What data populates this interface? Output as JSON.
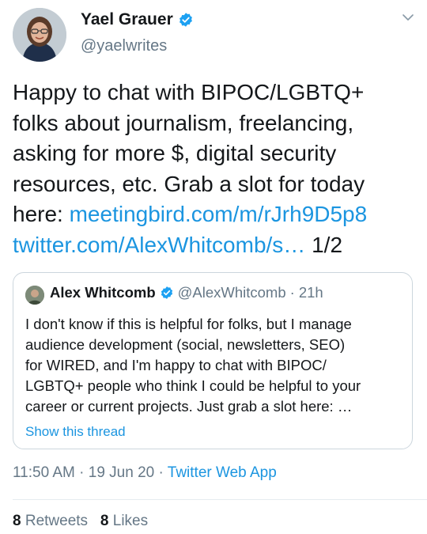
{
  "tweet": {
    "author_name": "Yael Grauer",
    "author_handle": "@yaelwrites",
    "verified_icon": "verified-badge-icon",
    "caret_icon": "chevron-down-icon",
    "text_lines": [
      "Happy to chat with BIPOC/LGBTQ+",
      "folks about journalism, freelancing,",
      "asking for more $, digital security",
      "resources, etc. Grab a slot for today"
    ],
    "line5_prefix": "here: ",
    "link1": "meetingbird.com/m/rJrh9D5p8",
    "link2": "twitter.com/AlexWhitcomb/s…",
    "thread_count": " 1/2",
    "time": "11:50 AM",
    "sep": " · ",
    "date": "19 Jun 20",
    "source": "Twitter Web App"
  },
  "quote": {
    "author_name": "Alex Whitcomb",
    "author_handle": "@AlexWhitcomb",
    "time_ago": "21h",
    "text_lines": [
      "I don't know if this is helpful for folks, but I manage",
      "audience development (social, newsletters, SEO)",
      "for WIRED, and I'm happy to chat with BIPOC/",
      "LGBTQ+ people who think I could be helpful to your",
      "career or current projects. Just grab a slot here: …"
    ],
    "show_thread": "Show this thread"
  },
  "stats": {
    "retweets_count": "8",
    "retweets_label": "Retweets",
    "likes_count": "8",
    "likes_label": "Likes"
  },
  "colors": {
    "link": "#1b95e0",
    "muted": "#657786",
    "text": "#14171a",
    "border": "#ccd6dd"
  }
}
